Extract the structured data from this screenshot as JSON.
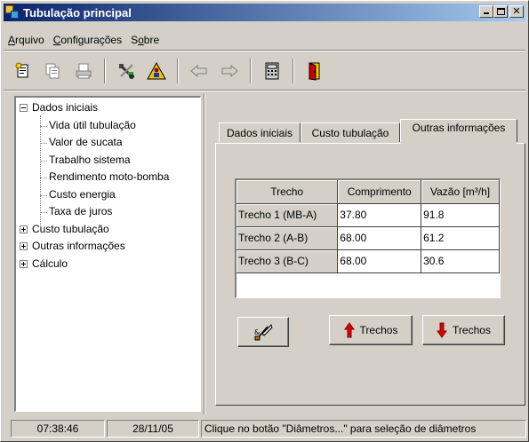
{
  "window": {
    "title": "Tubulação principal"
  },
  "menu": {
    "items": [
      {
        "label": "Arquivo"
      },
      {
        "label": "Configurações"
      },
      {
        "label": "Sobre"
      }
    ]
  },
  "toolbar": {
    "icons": [
      "new-report-icon",
      "copy-report-icon",
      "print-icon",
      "tools-icon",
      "warning-person-icon",
      "back-arrow-icon",
      "forward-arrow-icon",
      "calculator-icon",
      "exit-door-icon"
    ]
  },
  "tree": {
    "nodes": [
      {
        "label": "Dados iniciais",
        "expanded": true
      },
      {
        "label": "Vida útil tubulação"
      },
      {
        "label": "Valor de sucata"
      },
      {
        "label": "Trabalho sistema"
      },
      {
        "label": "Rendimento moto-bomba"
      },
      {
        "label": "Custo energia"
      },
      {
        "label": "Taxa de juros"
      },
      {
        "label": "Custo tubulação",
        "expanded": false
      },
      {
        "label": "Outras informações",
        "expanded": false
      },
      {
        "label": "Cálculo",
        "expanded": false
      }
    ]
  },
  "tabs": [
    {
      "label": "Dados iniciais"
    },
    {
      "label": "Custo tubulação"
    },
    {
      "label": "Outras informações",
      "active": true
    }
  ],
  "grid": {
    "headers": [
      "Trecho",
      "Comprimento",
      "Vazão [m³/h]"
    ],
    "rows": [
      [
        "Trecho 1 (MB-A)",
        "37.80",
        "91.8"
      ],
      [
        "Trecho 2 (A-B)",
        "68.00",
        "61.2"
      ],
      [
        "Trecho 3 (B-C)",
        "68.00",
        "30.6"
      ]
    ]
  },
  "buttons": {
    "clear_icon": "eraser-icon",
    "add_label": "Trechos",
    "remove_label": "Trechos"
  },
  "colors": {
    "title_start": "#0a246a",
    "title_end": "#a6caf0",
    "face": "#d4d0c8",
    "arrow_red": "#e00000"
  },
  "status": {
    "time": "07:38:46",
    "date": "28/11/05",
    "message": "Clique no botão \"Diâmetros...\" para seleção de diâmetros"
  }
}
